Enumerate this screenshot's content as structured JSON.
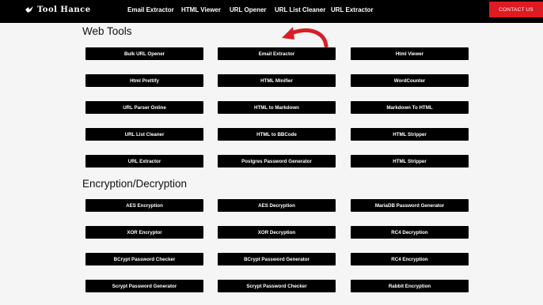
{
  "brand": {
    "name": "Tool Hance",
    "icon": "bird-logo-icon"
  },
  "nav": [
    "Email Extractor",
    "HTML Viewer",
    "URL Opener",
    "URL List Cleaner",
    "URL Extractor"
  ],
  "contact_label": "CONTACT US",
  "colors": {
    "accent": "#e01a22",
    "button_bg": "#000000",
    "topbar": "#000000"
  },
  "sections": [
    {
      "title": "Web Tools",
      "rows": [
        [
          "Bulk URL Opener",
          "Email Extractor",
          "Html Viewer"
        ],
        [
          "Html Prettify",
          "HTML Minifier",
          "WordCounter"
        ],
        [
          "URL Parser Online",
          "HTML to Markdown",
          "Markdown To HTML"
        ],
        [
          "URL List Cleaner",
          "HTML to BBCode",
          "HTML Stripper"
        ],
        [
          "URL Extractor",
          "Postgres Password Generator",
          "HTML Stripper"
        ]
      ]
    },
    {
      "title": "Encryption/Decryption",
      "rows": [
        [
          "AES Encryption",
          "AES Decryption",
          "MariaDB Password Generator"
        ],
        [
          "XOR Encryptor",
          "XOR Decryption",
          "RC4 Decryption"
        ],
        [
          "BCrypt Password Checker",
          "BCrypt Password Generator",
          "RC4 Encryption"
        ],
        [
          "Scrypt Password Generator",
          "Scrypt Password Checker",
          "Rabbit Encryption"
        ]
      ]
    }
  ],
  "annotation": {
    "icon": "red-arrow-icon",
    "points_to": "Email Extractor"
  }
}
